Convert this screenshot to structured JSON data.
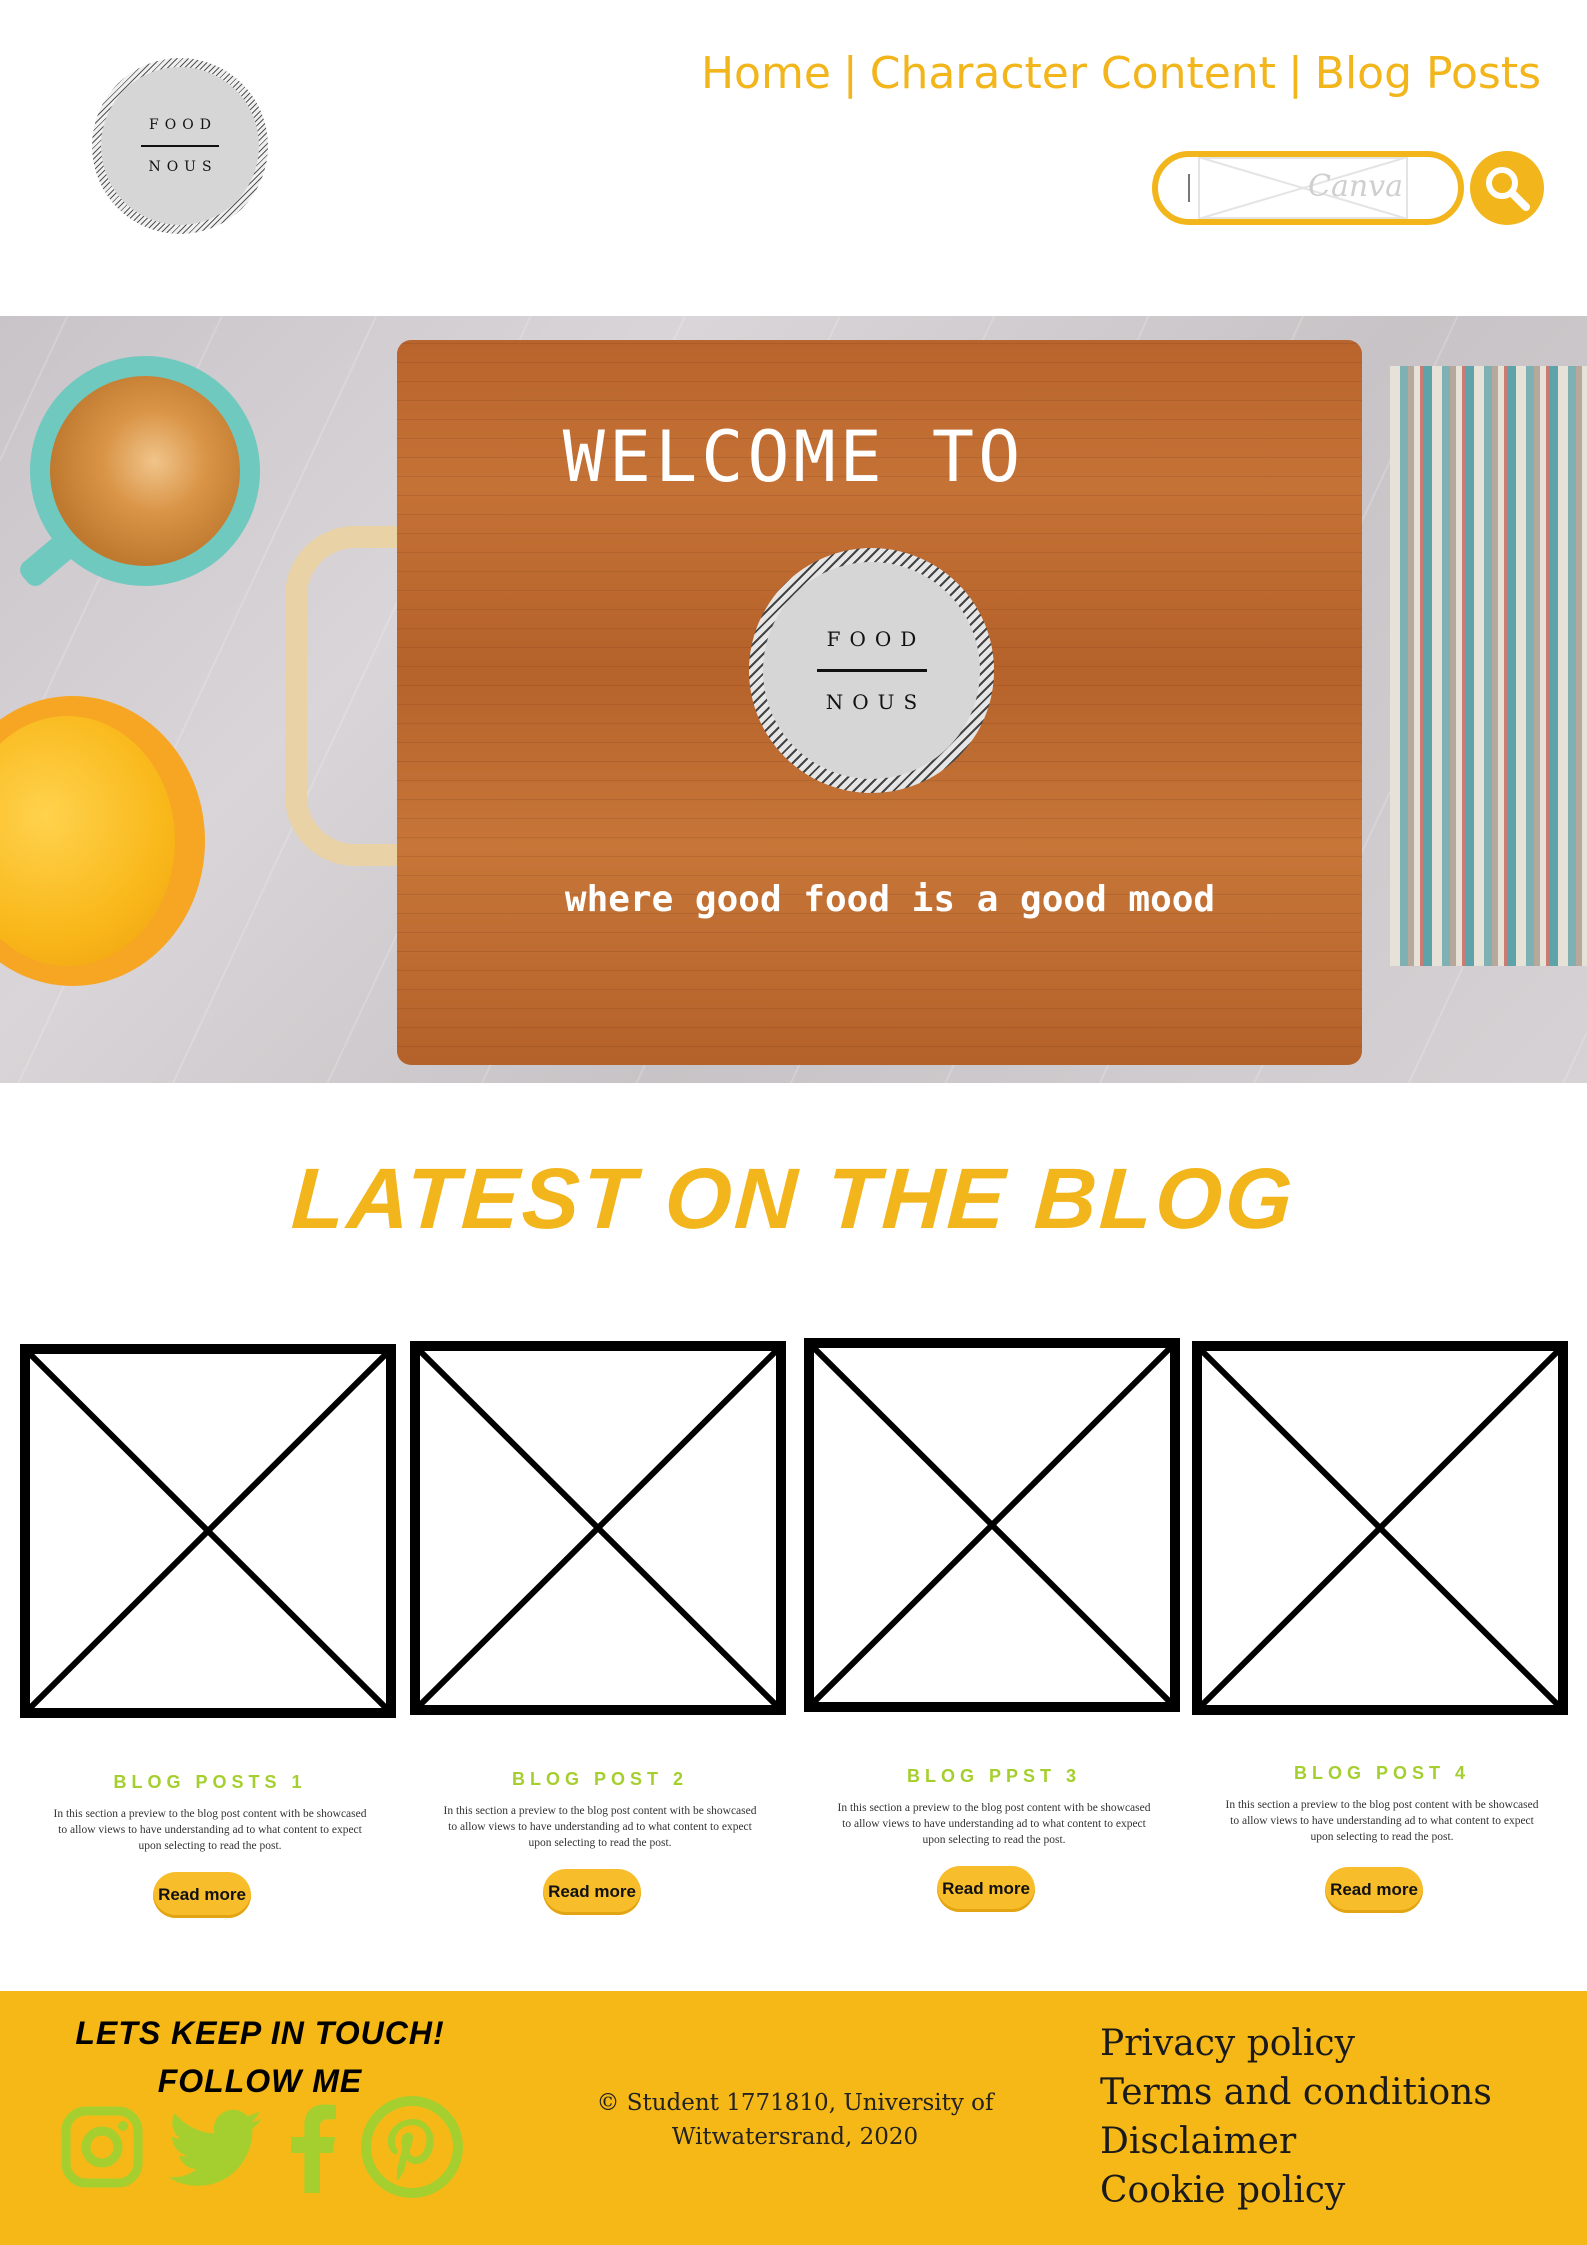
{
  "brand": {
    "line1": "FOOD",
    "line2": "NOUS"
  },
  "nav": {
    "items": [
      "Home",
      "Character Content",
      "Blog Posts"
    ],
    "separator": "|"
  },
  "search": {
    "placeholder": "Canva",
    "button_icon": "search-icon"
  },
  "hero": {
    "welcome": "WELCOME TO",
    "tagline": "where good food is a good mood"
  },
  "latest": {
    "title": "LATEST ON THE BLOG"
  },
  "posts": [
    {
      "title": "BLOG POSTS 1",
      "desc": "In this section a preview to the blog post content with be showcased to allow views to have understanding ad to what content to expect upon selecting to read the post.",
      "button": "Read more"
    },
    {
      "title": "BLOG POST 2",
      "desc": "In this section a preview to the blog post content with be showcased to allow views to have understanding ad to what content to expect upon selecting to read the post.",
      "button": "Read more"
    },
    {
      "title": "BLOG PPST 3",
      "desc": "In this section a preview to the blog post content with be showcased to allow views to have understanding ad to what content to expect upon selecting to read the post.",
      "button": "Read more"
    },
    {
      "title": "BLOG POST 4",
      "desc": "In this section a preview to the blog post content with be showcased to allow views to have understanding ad to what content to expect upon selecting to read the post.",
      "button": "Read more"
    }
  ],
  "footer": {
    "keep_line1": "LETS KEEP IN TOUCH!",
    "keep_line2": "FOLLOW ME",
    "socials": [
      "instagram-icon",
      "twitter-icon",
      "facebook-icon",
      "pinterest-icon"
    ],
    "copyright": "© Student 1771810, University of Witwatersrand, 2020",
    "links": [
      "Privacy policy",
      "Terms and conditions",
      "Disclaimer",
      "Cookie policy"
    ]
  },
  "colors": {
    "accent": "#f2b51b",
    "footer_bg": "#f6b817",
    "post_title": "#a5cf2f",
    "social": "#a5cf2f"
  }
}
